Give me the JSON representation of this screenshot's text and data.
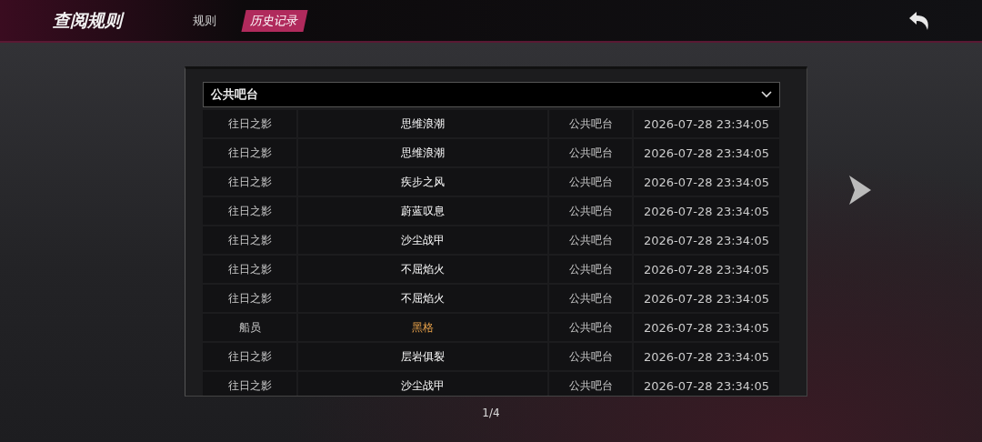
{
  "header": {
    "title": "查阅规则",
    "tabs": [
      {
        "label": "规则",
        "selected": false
      },
      {
        "label": "历史记录",
        "selected": true
      }
    ]
  },
  "filter": {
    "value": "公共吧台"
  },
  "table": {
    "rows": [
      {
        "role": "往日之影",
        "name": "思维浪潮",
        "place": "公共吧台",
        "time": "2026-07-28 23:34:05",
        "highlighted": false
      },
      {
        "role": "往日之影",
        "name": "思维浪潮",
        "place": "公共吧台",
        "time": "2026-07-28 23:34:05",
        "highlighted": false
      },
      {
        "role": "往日之影",
        "name": "疾步之风",
        "place": "公共吧台",
        "time": "2026-07-28 23:34:05",
        "highlighted": false
      },
      {
        "role": "往日之影",
        "name": "蔚蓝叹息",
        "place": "公共吧台",
        "time": "2026-07-28 23:34:05",
        "highlighted": false
      },
      {
        "role": "往日之影",
        "name": "沙尘战甲",
        "place": "公共吧台",
        "time": "2026-07-28 23:34:05",
        "highlighted": false
      },
      {
        "role": "往日之影",
        "name": "不屈焰火",
        "place": "公共吧台",
        "time": "2026-07-28 23:34:05",
        "highlighted": false
      },
      {
        "role": "往日之影",
        "name": "不屈焰火",
        "place": "公共吧台",
        "time": "2026-07-28 23:34:05",
        "highlighted": false
      },
      {
        "role": "船员",
        "name": "黑格",
        "place": "公共吧台",
        "time": "2026-07-28 23:34:05",
        "highlighted": true
      },
      {
        "role": "往日之影",
        "name": "层岩俱裂",
        "place": "公共吧台",
        "time": "2026-07-28 23:34:05",
        "highlighted": false
      },
      {
        "role": "往日之影",
        "name": "沙尘战甲",
        "place": "公共吧台",
        "time": "2026-07-28 23:34:05",
        "highlighted": false
      }
    ]
  },
  "pagination": {
    "page": "1/4"
  }
}
